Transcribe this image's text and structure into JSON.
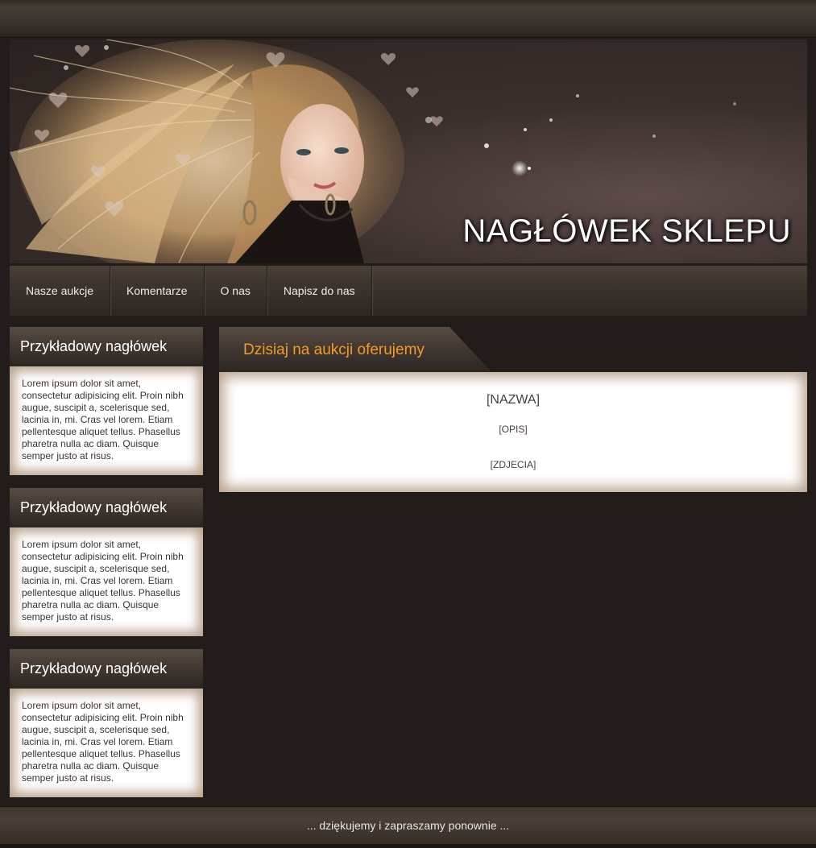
{
  "header": {
    "title": "NAGŁÓWEK SKLEPU",
    "banner": "woman-with-flowing-hair-banner"
  },
  "nav": {
    "items": [
      {
        "label": "Nasze aukcje"
      },
      {
        "label": "Komentarze"
      },
      {
        "label": "O nas"
      },
      {
        "label": "Napisz do nas"
      }
    ]
  },
  "sidebar": {
    "boxes": [
      {
        "heading": "Przykładowy nagłówek",
        "text": "Lorem ipsum dolor sit amet, consectetur adipisicing elit. Proin nibh augue, suscipit a, scelerisque sed, lacinia in, mi. Cras vel lorem. Etiam pellentesque aliquet tellus. Phasellus pharetra nulla ac diam. Quisque semper justo at risus."
      },
      {
        "heading": "Przykładowy nagłówek",
        "text": "Lorem ipsum dolor sit amet, consectetur adipisicing elit. Proin nibh augue, suscipit a, scelerisque sed, lacinia in, mi. Cras vel lorem. Etiam pellentesque aliquet tellus. Phasellus pharetra nulla ac diam. Quisque semper justo at risus."
      },
      {
        "heading": "Przykładowy nagłówek",
        "text": "Lorem ipsum dolor sit amet, consectetur adipisicing elit. Proin nibh augue, suscipit a, scelerisque sed, lacinia in, mi. Cras vel lorem. Etiam pellentesque aliquet tellus. Phasellus pharetra nulla ac diam. Quisque semper justo at risus."
      }
    ]
  },
  "main": {
    "tab_label": "Dzisiaj na aukcji oferujemy",
    "product": {
      "name": "[NAZWA]",
      "description": "[OPIS]",
      "photos": "[ZDJECIA]"
    }
  },
  "footer": {
    "text": "... dziękujemy i zapraszamy ponownie ..."
  },
  "colors": {
    "background": "#221d1a",
    "accent": "#f19b2c",
    "box_glow": "#b9a28e"
  }
}
